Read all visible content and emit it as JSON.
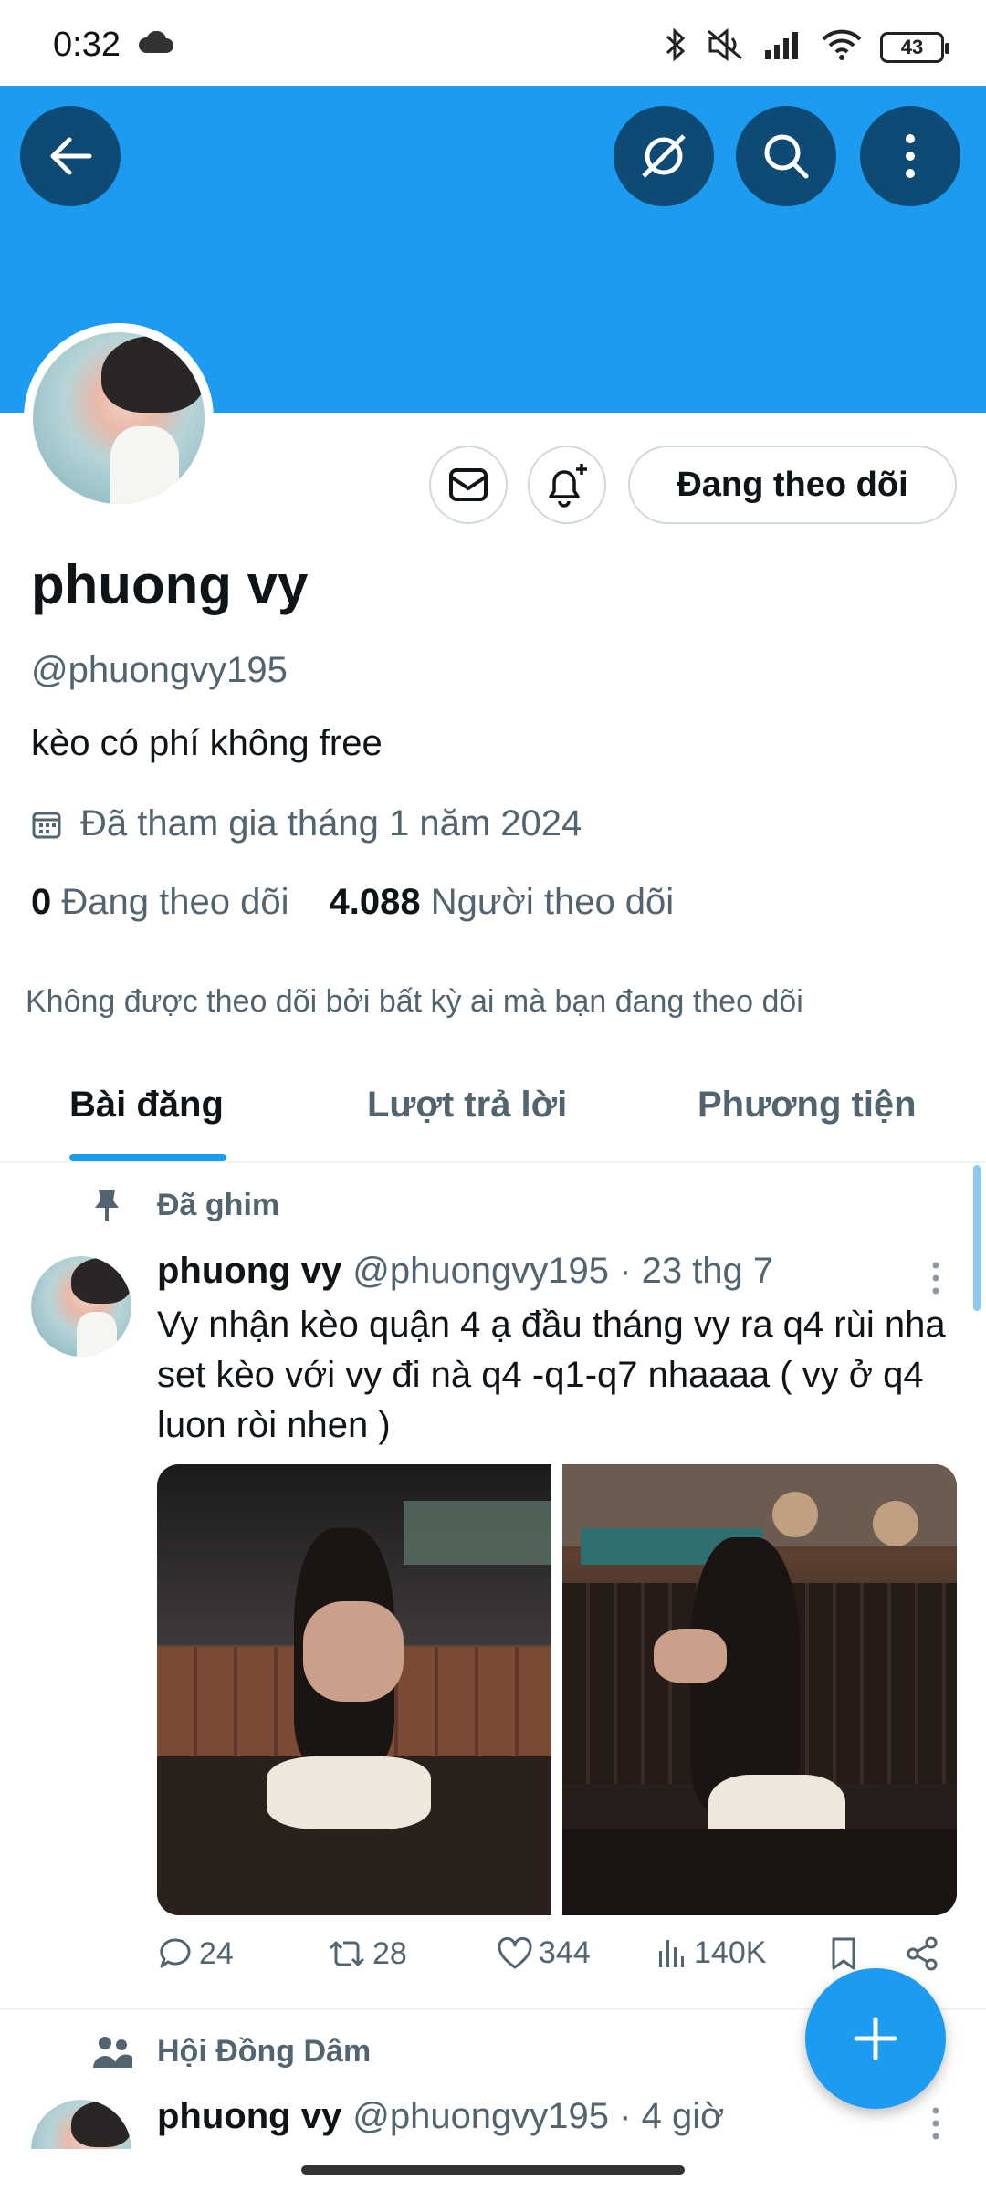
{
  "status_bar": {
    "time": "0:32",
    "battery": "43"
  },
  "header": {
    "back_icon": "arrow-left-icon",
    "translate_icon": "no-translate-icon",
    "search_icon": "search-icon",
    "more_icon": "more-vertical-icon",
    "banner_color": "#1d9bf0"
  },
  "profile": {
    "display_name": "phuong vy",
    "handle": "@phuongvy195",
    "bio": "kèo có phí không free",
    "joined": "Đã tham gia tháng 1 năm 2024",
    "following_count": "0",
    "following_label": "Đang theo dõi",
    "followers_count": "4.088",
    "followers_label": "Người theo dõi",
    "followed_by": "Không được theo dõi bởi bất kỳ ai mà bạn đang theo dõi",
    "follow_button_label": "Đang theo dõi"
  },
  "tabs": [
    {
      "label": "Bài đăng",
      "active": true
    },
    {
      "label": "Lượt trả lời",
      "active": false
    },
    {
      "label": "Phương tiện",
      "active": false
    }
  ],
  "pinned_tweet": {
    "pinned_label": "Đã ghim",
    "name": "phuong vy",
    "handle_time": "@phuongvy195 · 23 thg 7",
    "text": "Vy nhận kèo quận 4 ạ đầu tháng vy ra q4 rùi nha set kèo với vy đi nà q4 -q1-q7 nhaaaa ( vy ở q4 luon ròi nhen )",
    "replies": "24",
    "retweets": "28",
    "likes": "344",
    "views": "140K"
  },
  "second_tweet": {
    "community_label": "Hội Đồng Dâm",
    "name": "phuong vy",
    "handle_time": "@phuongvy195 · 4 giờ"
  },
  "fab": {
    "icon": "plus-icon",
    "color": "#1d9bf0"
  }
}
